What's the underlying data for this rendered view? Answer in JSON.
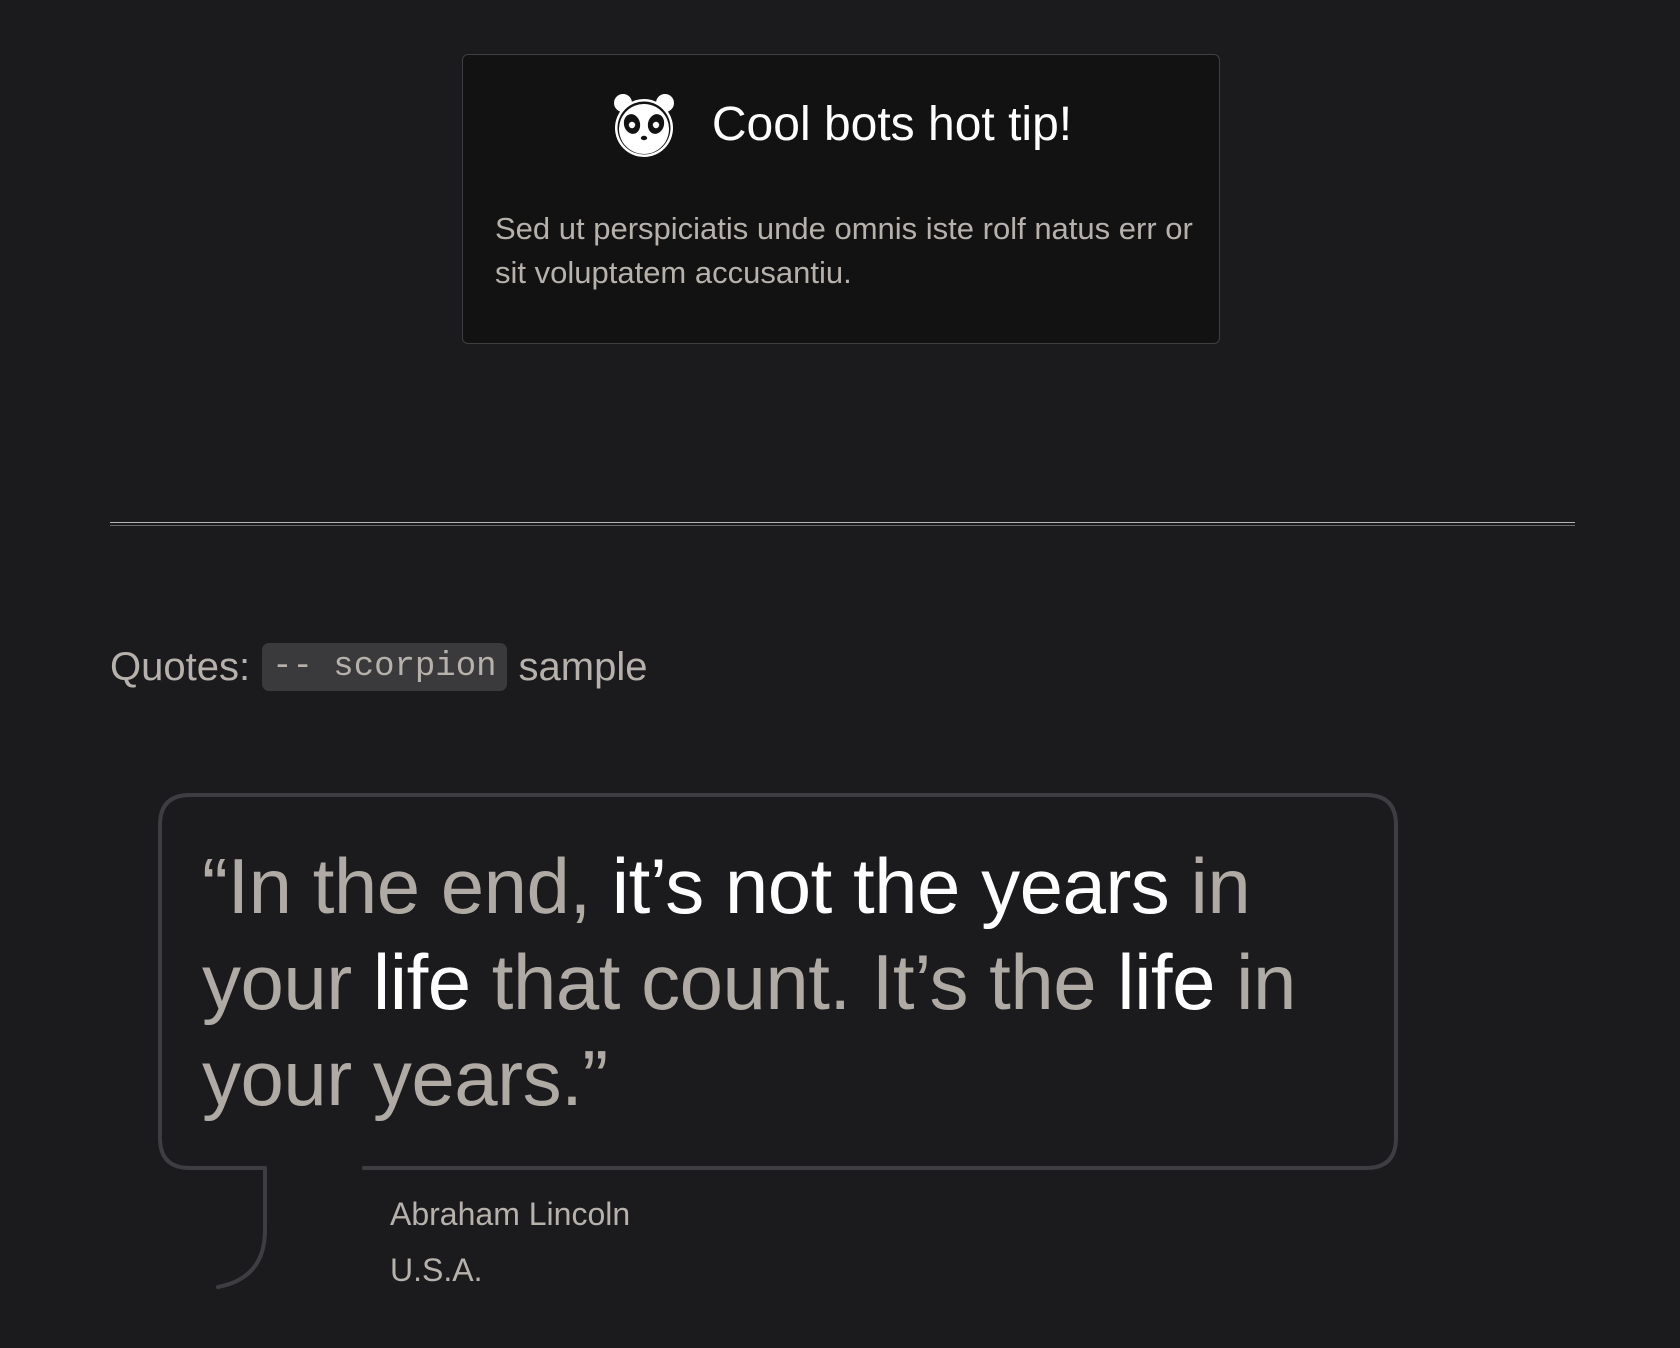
{
  "tip": {
    "icon": "panda-icon",
    "title": "Cool bots hot tip!",
    "body": "Sed ut perspiciatis unde omnis iste rolf natus err or sit voluptatem accusantiu."
  },
  "section": {
    "prefix": "Quotes:",
    "code": "-- scorpion",
    "suffix": "sample"
  },
  "quote": {
    "segments": [
      {
        "text": "“In the end, ",
        "highlight": false
      },
      {
        "text": "it’s not the years",
        "highlight": true
      },
      {
        "text": " in your ",
        "highlight": false
      },
      {
        "text": "life",
        "highlight": true
      },
      {
        "text": " that count. It’s the ",
        "highlight": false
      },
      {
        "text": "life",
        "highlight": true
      },
      {
        "text": " in your years.”",
        "highlight": false
      }
    ],
    "author": "Abraham Lincoln",
    "country": "U.S.A."
  },
  "colors": {
    "background": "#1b1b1e",
    "card_background": "#121213",
    "muted_text": "#b7b1ab",
    "highlight_text": "#ffffff",
    "bubble_border": "#3e3e42"
  }
}
